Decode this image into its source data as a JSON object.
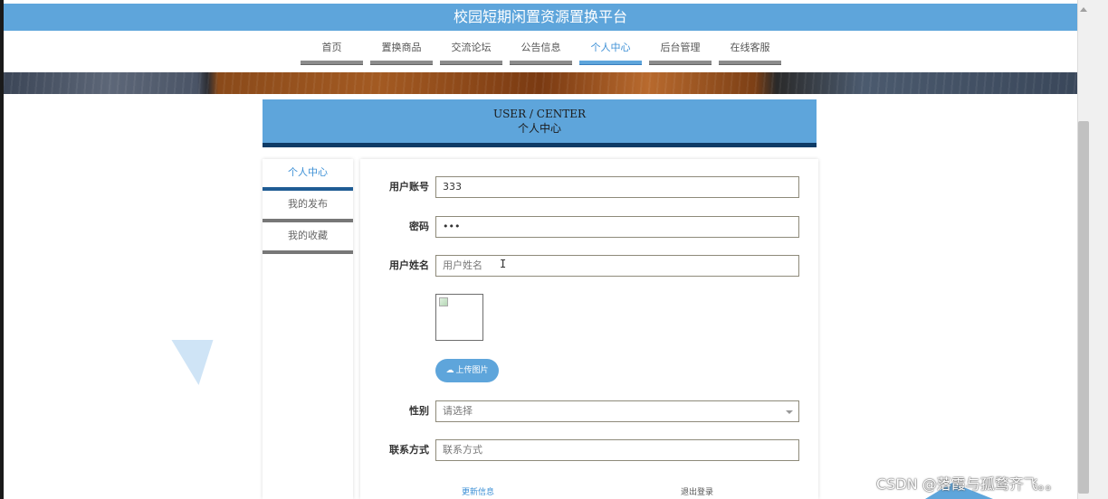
{
  "header": {
    "title": "校园短期闲置资源置换平台"
  },
  "nav": [
    {
      "label": "首页",
      "active": false
    },
    {
      "label": "置换商品",
      "active": false
    },
    {
      "label": "交流论坛",
      "active": false
    },
    {
      "label": "公告信息",
      "active": false
    },
    {
      "label": "个人中心",
      "active": true
    },
    {
      "label": "后台管理",
      "active": false
    },
    {
      "label": "在线客服",
      "active": false
    }
  ],
  "section": {
    "title_en": "USER / CENTER",
    "title_cn": "个人中心"
  },
  "sidebar": [
    {
      "label": "个人中心",
      "active": true
    },
    {
      "label": "我的发布",
      "active": false
    },
    {
      "label": "我的收藏",
      "active": false
    }
  ],
  "form": {
    "account": {
      "label": "用户账号",
      "value": "333"
    },
    "password": {
      "label": "密码",
      "value": "•••"
    },
    "name": {
      "label": "用户姓名",
      "placeholder": "用户姓名"
    },
    "upload_button": "上传图片",
    "gender": {
      "label": "性别",
      "value": "请选择"
    },
    "contact": {
      "label": "联系方式",
      "placeholder": "联系方式"
    },
    "update_label": "更新信息",
    "logout_label": "退出登录"
  },
  "watermark": "CSDN @落霞与孤鹜齐飞。。",
  "colors": {
    "accent": "#5ea5db",
    "accent_dark": "#0e3b66",
    "nav_bar": "#8c8c8c"
  }
}
